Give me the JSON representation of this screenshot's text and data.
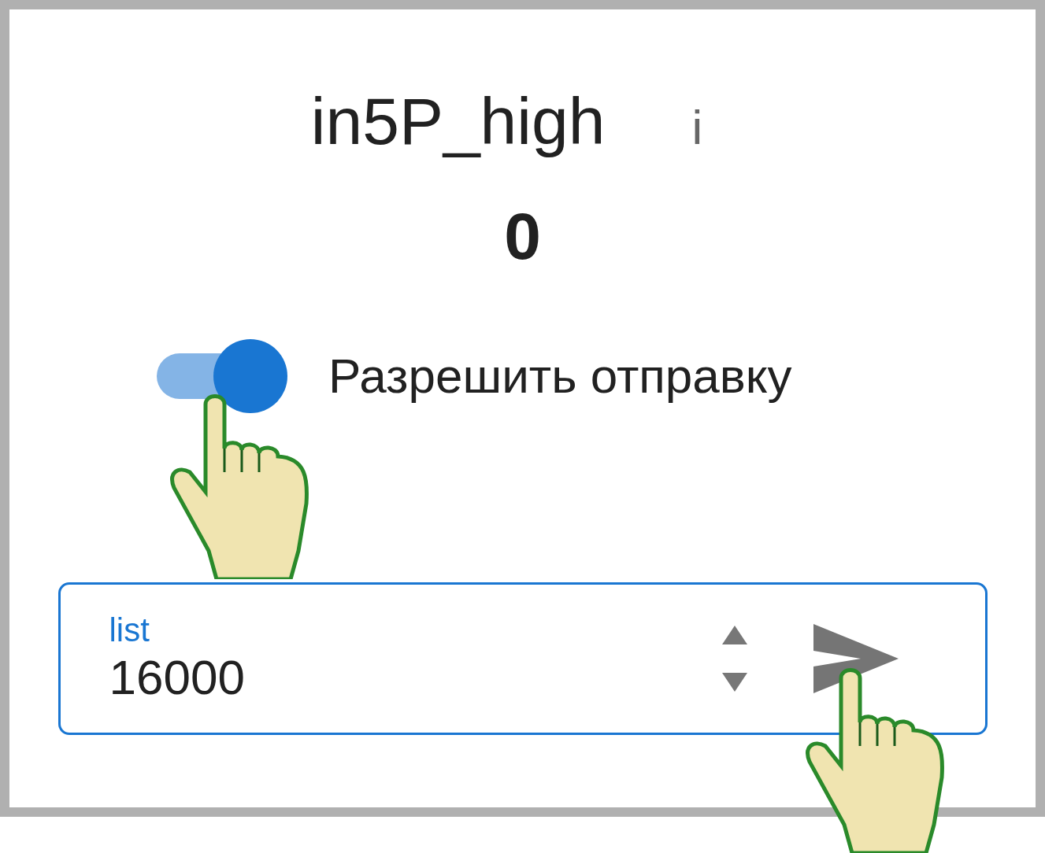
{
  "title": "in5P_high",
  "info_icon": "i",
  "value": "0",
  "toggle": {
    "label": "Разрешить отправку",
    "on": true
  },
  "field": {
    "label": "list",
    "value": "16000"
  }
}
